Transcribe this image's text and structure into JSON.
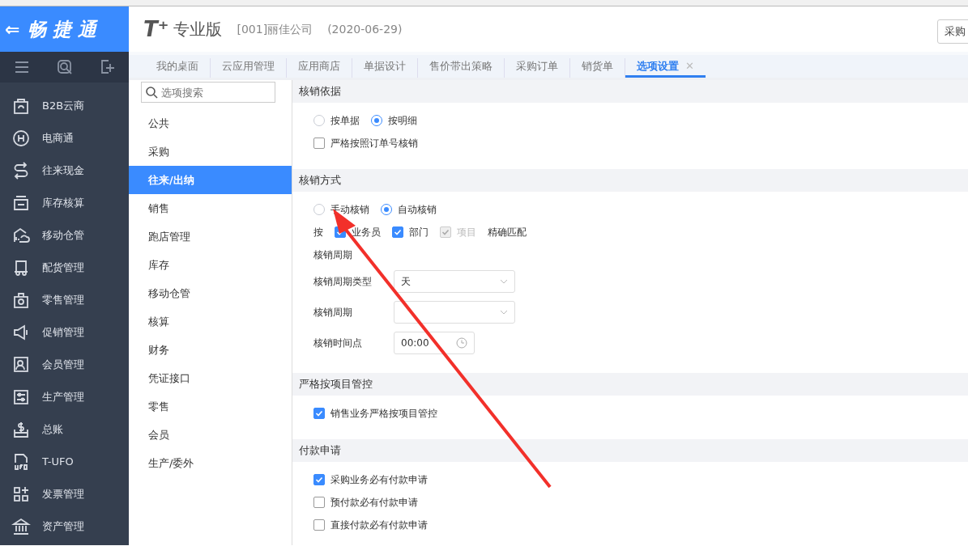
{
  "brand": {
    "back": "⇐",
    "name": "畅 捷 通"
  },
  "product": {
    "logo": "T⁺",
    "edition": "专业版",
    "company": "[001]丽佳公司",
    "date": "(2020-06-29)",
    "action": "采购"
  },
  "sidebar_tools": [
    {
      "kind": "menu"
    },
    {
      "kind": "search"
    },
    {
      "kind": "add"
    }
  ],
  "sidebar": {
    "items": [
      {
        "label": "B2B云商"
      },
      {
        "label": "电商通"
      },
      {
        "label": "往来现金"
      },
      {
        "label": "库存核算"
      },
      {
        "label": "移动仓管"
      },
      {
        "label": "配货管理"
      },
      {
        "label": "零售管理"
      },
      {
        "label": "促销管理"
      },
      {
        "label": "会员管理"
      },
      {
        "label": "生产管理"
      },
      {
        "label": "总账"
      },
      {
        "label": "T-UFO"
      },
      {
        "label": "发票管理"
      },
      {
        "label": "资产管理"
      }
    ]
  },
  "tabs": [
    {
      "label": "我的桌面",
      "selected": false
    },
    {
      "label": "云应用管理",
      "selected": false
    },
    {
      "label": "应用商店",
      "selected": false
    },
    {
      "label": "单据设计",
      "selected": false
    },
    {
      "label": "售价带出策略",
      "selected": false
    },
    {
      "label": "采购订单",
      "selected": false
    },
    {
      "label": "销货单",
      "selected": false
    },
    {
      "label": "选项设置",
      "selected": true,
      "close": "✕"
    }
  ],
  "options": {
    "search": {
      "placeholder": "选项搜索"
    },
    "items": [
      {
        "label": "公共",
        "selected": false
      },
      {
        "label": "采购",
        "selected": false
      },
      {
        "label": "往来/出纳",
        "selected": true
      },
      {
        "label": "销售",
        "selected": false
      },
      {
        "label": "跑店管理",
        "selected": false
      },
      {
        "label": "库存",
        "selected": false
      },
      {
        "label": "移动仓管",
        "selected": false
      },
      {
        "label": "核算",
        "selected": false
      },
      {
        "label": "财务",
        "selected": false
      },
      {
        "label": "凭证接口",
        "selected": false
      },
      {
        "label": "零售",
        "selected": false
      },
      {
        "label": "会员",
        "selected": false
      },
      {
        "label": "生产/委外",
        "selected": false
      }
    ]
  },
  "sections": [
    {
      "title": "核销依据",
      "rows": [
        {
          "kind": "radios",
          "items": [
            {
              "label": "按单据",
              "selected": false
            },
            {
              "label": "按明细",
              "selected": true
            }
          ]
        },
        {
          "kind": "checks",
          "items": [
            {
              "label": "严格按照订单号核销",
              "checked": false,
              "disabled": false
            }
          ]
        }
      ]
    },
    {
      "title": "核销方式",
      "rows": [
        {
          "kind": "radios",
          "items": [
            {
              "label": "手动核销",
              "selected": false
            },
            {
              "label": "自动核销",
              "selected": true
            }
          ]
        },
        {
          "kind": "checks",
          "prefix": "按",
          "suffix": "精确匹配",
          "items": [
            {
              "label": "业务员",
              "checked": true,
              "disabled": false
            },
            {
              "label": "部门",
              "checked": true,
              "disabled": false
            },
            {
              "label": "项目",
              "checked": true,
              "disabled": true
            }
          ]
        },
        {
          "kind": "label",
          "label": "核销周期"
        },
        {
          "kind": "select",
          "label": "核销周期类型",
          "value": "天"
        },
        {
          "kind": "select",
          "label": "核销周期",
          "value": ""
        },
        {
          "kind": "time",
          "label": "核销时间点",
          "value": "00:00"
        }
      ]
    },
    {
      "title": "严格按项目管控",
      "rows": [
        {
          "kind": "checks",
          "items": [
            {
              "label": "销售业务严格按项目管控",
              "checked": true,
              "disabled": false
            }
          ]
        }
      ]
    },
    {
      "title": "付款申请",
      "rows": [
        {
          "kind": "checks",
          "items": [
            {
              "label": "采购业务必有付款申请",
              "checked": true,
              "disabled": false
            }
          ]
        },
        {
          "kind": "checks",
          "items": [
            {
              "label": "预付款必有付款申请",
              "checked": false,
              "disabled": false
            }
          ]
        },
        {
          "kind": "checks",
          "items": [
            {
              "label": "直接付款必有付款申请",
              "checked": false,
              "disabled": false
            }
          ]
        }
      ]
    }
  ]
}
